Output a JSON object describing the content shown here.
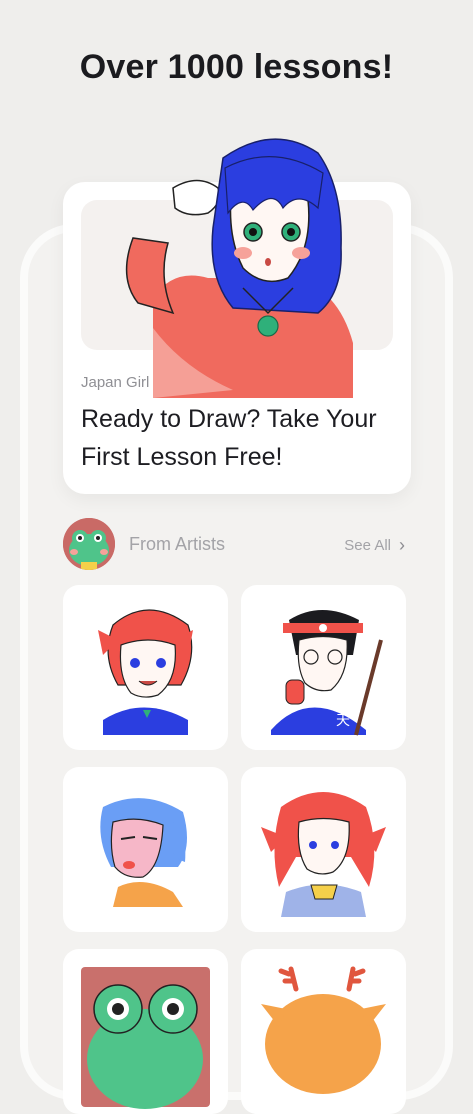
{
  "headline": "Over 1000 lessons!",
  "featured": {
    "category": "Japan Girl",
    "title": "Ready to Draw? Take Your First Lesson Free!"
  },
  "section": {
    "title": "From Artists",
    "see_all": "See All",
    "chevron": "›"
  },
  "colors": {
    "background": "#efeeec",
    "card": "#ffffff",
    "text_primary": "#1d1d22",
    "text_muted": "#a3a3a7",
    "accent_red": "#f0524a",
    "accent_blue": "#2b3ee0"
  },
  "tiles": [
    {
      "icon": "red-haired-boy-illustration"
    },
    {
      "icon": "samurai-boy-illustration"
    },
    {
      "icon": "blue-haired-girl-illustration"
    },
    {
      "icon": "red-haired-girl-illustration"
    },
    {
      "icon": "frog-illustration"
    },
    {
      "icon": "reindeer-illustration"
    }
  ]
}
